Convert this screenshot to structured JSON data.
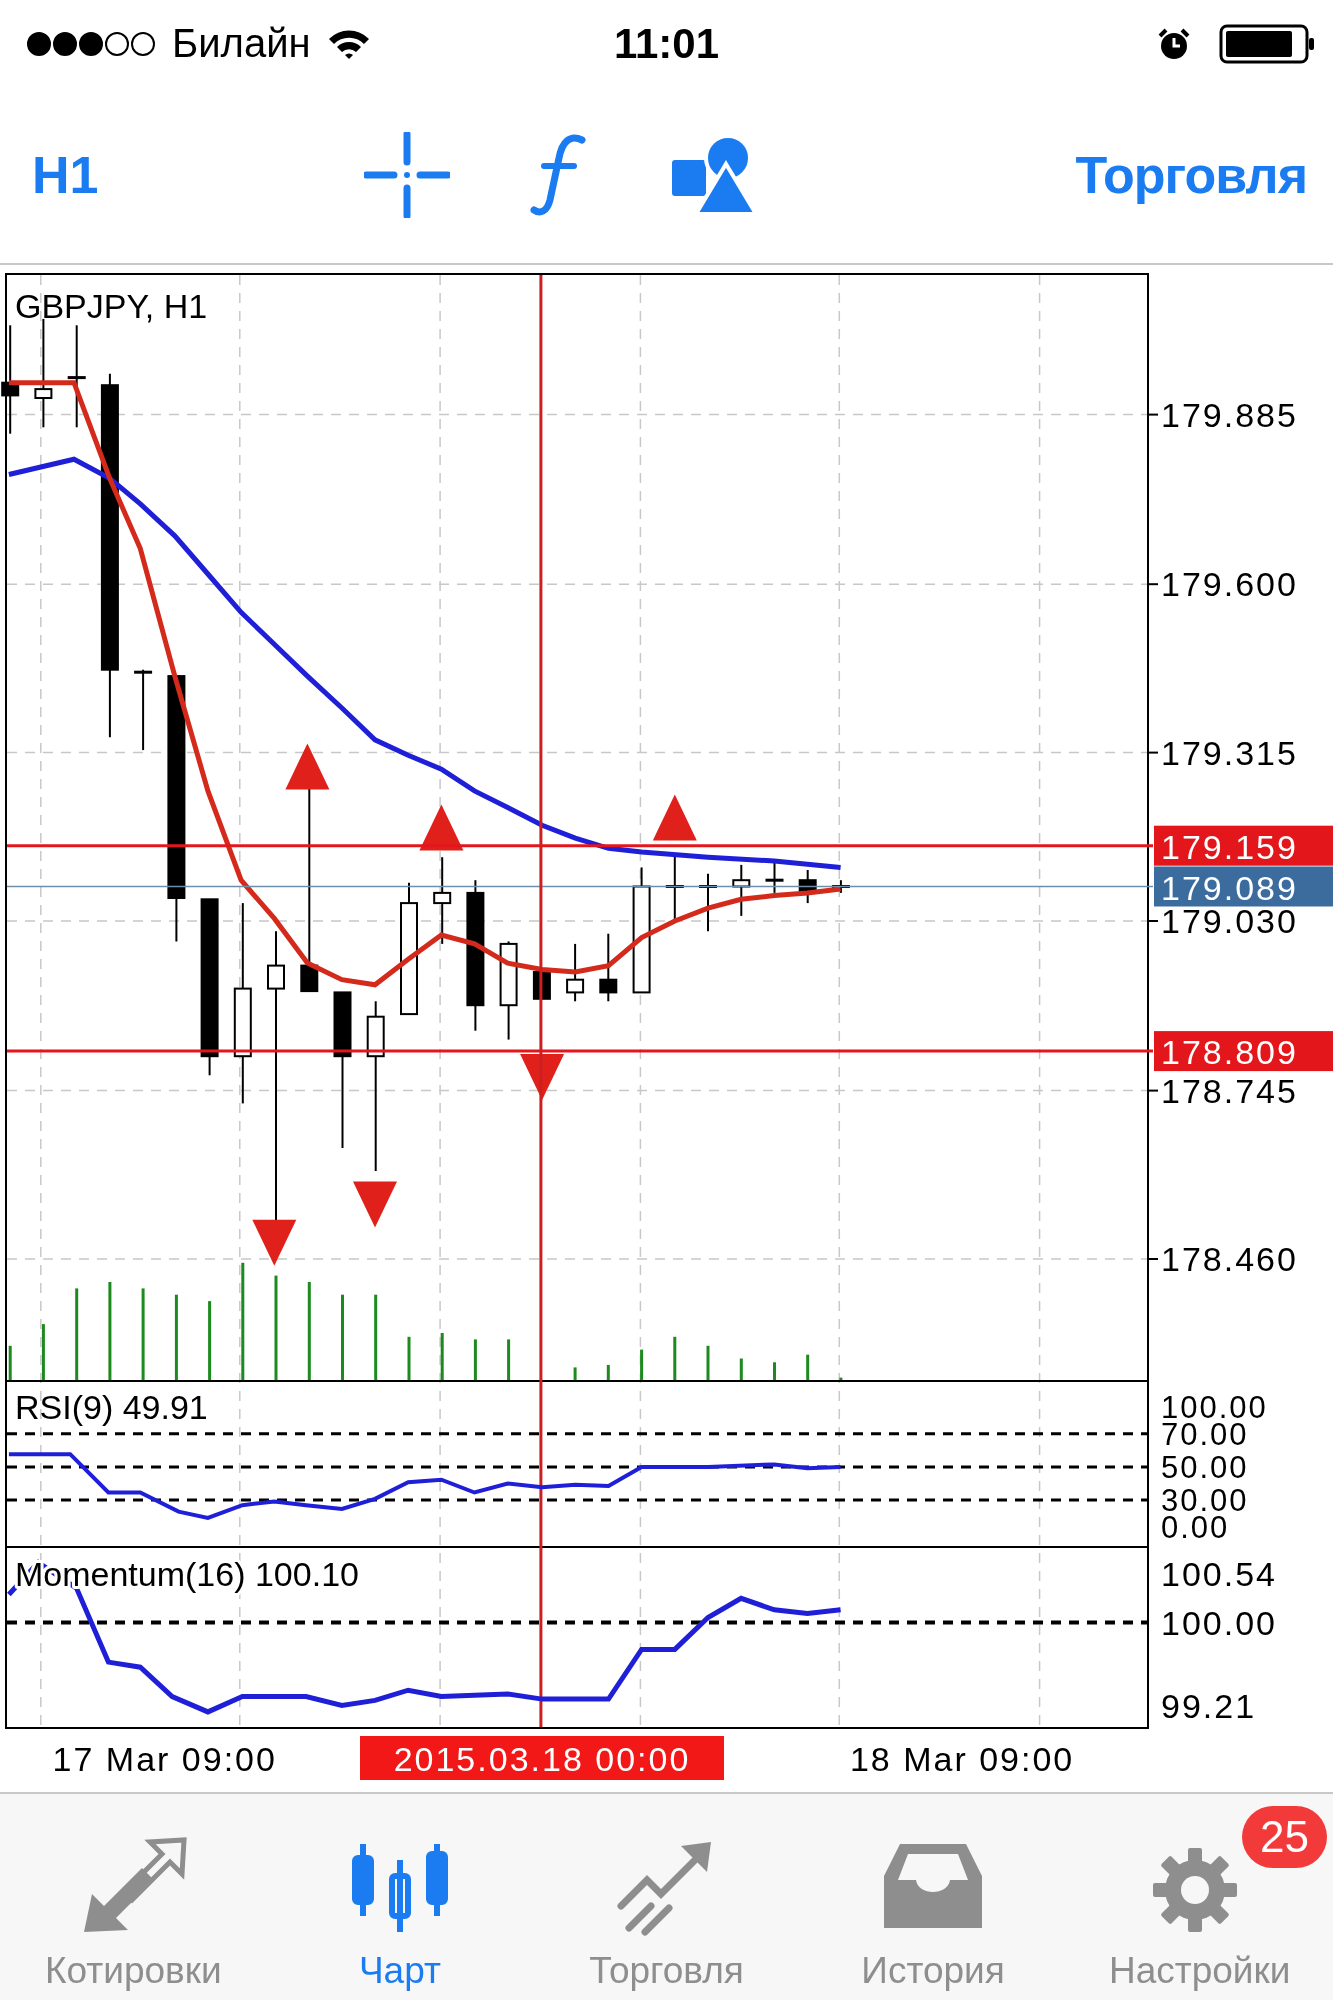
{
  "status_bar": {
    "carrier": "Билайн",
    "time": "11:01"
  },
  "toolbar": {
    "period": "H1",
    "trade_button": "Торговля"
  },
  "chart": {
    "title": "GBPJPY, H1",
    "price_ticks": [
      "179.885",
      "179.600",
      "179.315",
      "179.030",
      "178.745",
      "178.460"
    ],
    "price_lines": [
      {
        "label": "179.159",
        "kind": "level"
      },
      {
        "label": "179.089",
        "kind": "bid"
      },
      {
        "label": "178.809",
        "kind": "level"
      }
    ],
    "rsi": {
      "label": "RSI(9) 49.91",
      "ticks": [
        "100.00",
        "70.00",
        "50.00",
        "30.00",
        "0.00"
      ]
    },
    "momentum": {
      "label": "Momentum(16) 100.10",
      "ticks": [
        "100.54",
        "100.00",
        "99.21"
      ]
    },
    "time_labels": [
      {
        "label": "17 Mar 09:00",
        "kind": "tick"
      },
      {
        "label": "2015.03.18 00:00",
        "kind": "crosshair"
      },
      {
        "label": "18 Mar 09:00",
        "kind": "tick"
      }
    ]
  },
  "tabs": [
    {
      "label": "Котировки",
      "selected": false
    },
    {
      "label": "Чарт",
      "selected": true
    },
    {
      "label": "Торговля",
      "selected": false
    },
    {
      "label": "История",
      "selected": false
    },
    {
      "label": "Настройки",
      "selected": false,
      "badge": "25"
    }
  ]
}
